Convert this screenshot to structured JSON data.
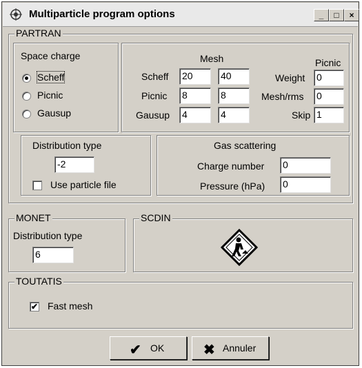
{
  "window": {
    "title": "Multiparticle program options",
    "minimize": "_",
    "maximize": "□",
    "close": "×"
  },
  "partran": {
    "legend": "PARTRAN",
    "space_charge": {
      "title": "Space charge",
      "options": [
        "Scheff",
        "Picnic",
        "Gausup"
      ],
      "selected": "Scheff"
    },
    "mesh": {
      "title": "Mesh",
      "rows": [
        {
          "label": "Scheff",
          "a": "20",
          "b": "40"
        },
        {
          "label": "Picnic",
          "a": "8",
          "b": "8"
        },
        {
          "label": "Gausup",
          "a": "4",
          "b": "4"
        }
      ]
    },
    "picnic": {
      "title": "Picnic",
      "weight_label": "Weight",
      "weight": "0",
      "meshrms_label": "Mesh/rms",
      "meshrms": "0",
      "skip_label": "Skip",
      "skip": "1"
    },
    "distribution": {
      "title": "Distribution type",
      "value": "-2",
      "use_file_label": "Use particle file",
      "use_file": false
    },
    "gas": {
      "title": "Gas scattering",
      "charge_label": "Charge number",
      "charge": "0",
      "pressure_label": "Pressure (hPa)",
      "pressure": "0"
    }
  },
  "monet": {
    "legend": "MONET",
    "dist_label": "Distribution type",
    "dist_value": "6"
  },
  "scdin": {
    "legend": "SCDIN",
    "icon": "under-construction-icon"
  },
  "toutatis": {
    "legend": "TOUTATIS",
    "fast_mesh_label": "Fast mesh",
    "fast_mesh": true
  },
  "buttons": {
    "ok": "OK",
    "cancel": "Annuler"
  },
  "colors": {
    "face": "#d4d0c8",
    "shadow": "#808080",
    "ok_check": "#000000"
  }
}
